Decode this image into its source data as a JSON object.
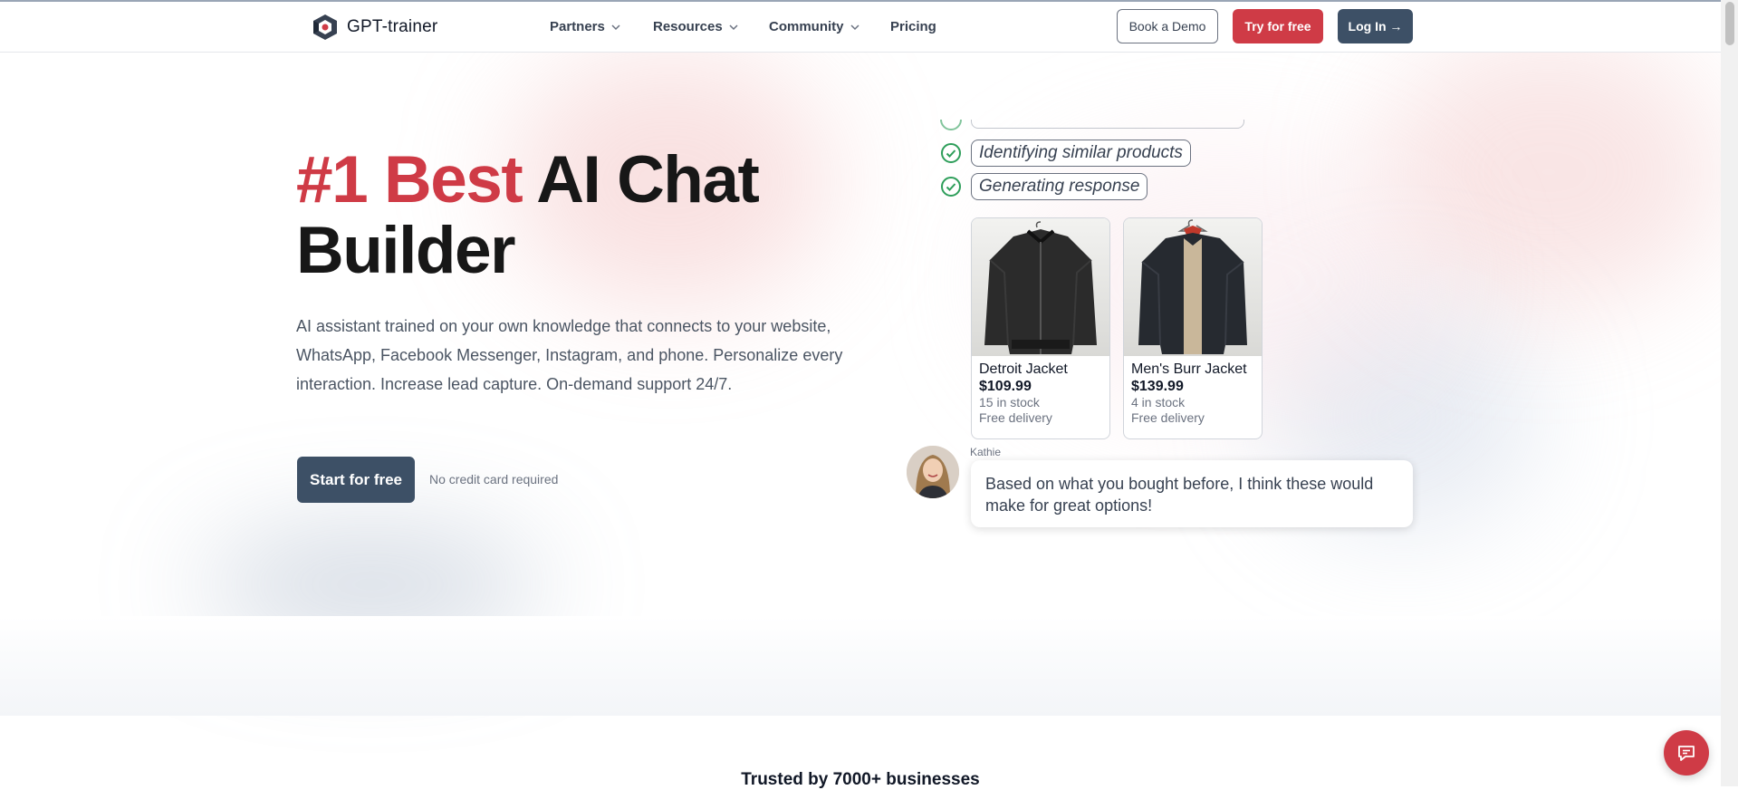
{
  "brand": {
    "name": "GPT-trainer",
    "accent": "#cf3b46",
    "dark": "#3d5066"
  },
  "nav": {
    "items": [
      {
        "label": "Partners",
        "has_dropdown": true
      },
      {
        "label": "Resources",
        "has_dropdown": true
      },
      {
        "label": "Community",
        "has_dropdown": true
      },
      {
        "label": "Pricing",
        "has_dropdown": false
      }
    ],
    "book_demo": "Book a Demo",
    "try_free": "Try for free",
    "login": "Log In →"
  },
  "hero": {
    "title_accent": "#1 Best",
    "title_rest": "AI Chat Builder",
    "description": "AI assistant trained on your own knowledge that connects to your website, WhatsApp, Facebook Messenger, Instagram, and phone. Personalize every interaction. Increase lead capture. On-demand support 24/7.",
    "cta": "Start for free",
    "cta_note": "No credit card required"
  },
  "chat_demo": {
    "steps": [
      {
        "label": "Identifying similar products",
        "status": "done"
      },
      {
        "label": "Generating response",
        "status": "done"
      }
    ],
    "products": [
      {
        "name": "Detroit Jacket",
        "price": "$109.99",
        "stock": "15 in stock",
        "delivery": "Free delivery"
      },
      {
        "name": "Men's Burr Jacket",
        "price": "$139.99",
        "stock": "4 in stock",
        "delivery": "Free delivery"
      }
    ],
    "agent_name": "Kathie",
    "message": "Based on what you bought before, I think these would make for great options!"
  },
  "trusted": "Trusted by 7000+ businesses",
  "icons": [
    "logo-icon",
    "chevron-down-icon",
    "check-circle-icon",
    "arrow-right-icon",
    "chat-icon"
  ]
}
